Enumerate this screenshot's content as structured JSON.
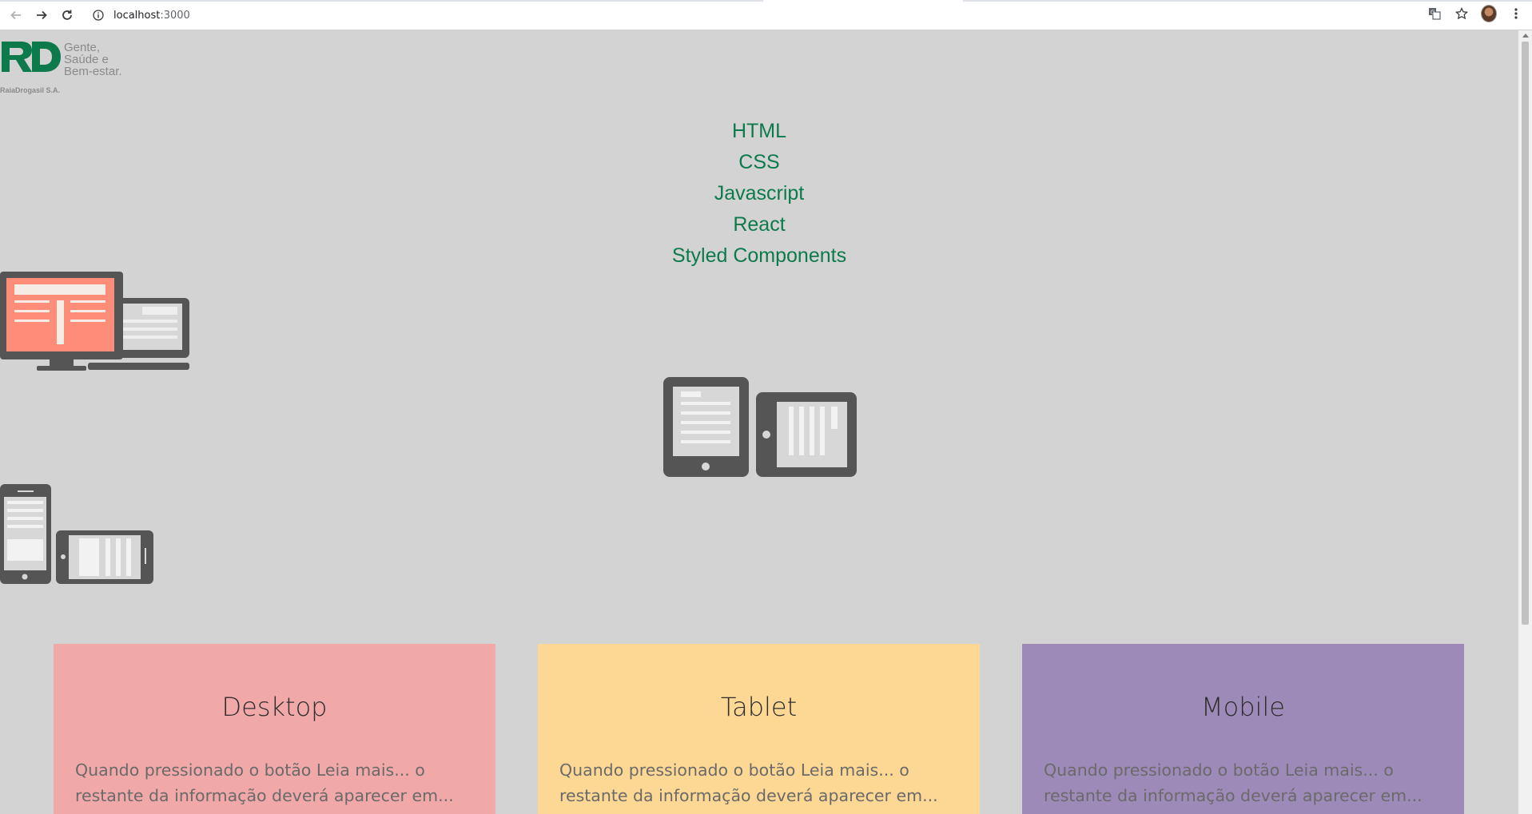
{
  "browser": {
    "url_host": "localhost",
    "url_port": ":3000"
  },
  "logo": {
    "tagline_lines": [
      "Gente,",
      "Saúde e",
      "Bem-estar."
    ],
    "company": "RaiaDrogasil S.A.",
    "brand_color": "#0c7a4b"
  },
  "tech_list": [
    "HTML",
    "CSS",
    "Javascript",
    "React",
    "Styled Components"
  ],
  "cards": [
    {
      "title": "Desktop",
      "text": "Quando pressionado o botão Leia mais... o restante da informação deverá aparecer em...",
      "color": "#f0a8a8"
    },
    {
      "title": "Tablet",
      "text": "Quando pressionado o botão Leia mais... o restante da informação deverá aparecer em...",
      "color": "#fdd794"
    },
    {
      "title": "Mobile",
      "text": "Quando pressionado o botão Leia mais... o restante da informação deverá aparecer em...",
      "color": "#9d8ab8"
    }
  ],
  "icons": {
    "back": "arrow-left-icon",
    "forward": "arrow-right-icon",
    "reload": "reload-icon",
    "info": "info-icon",
    "translate": "translate-icon",
    "bookmark": "star-icon",
    "menu": "kebab-menu-icon"
  }
}
